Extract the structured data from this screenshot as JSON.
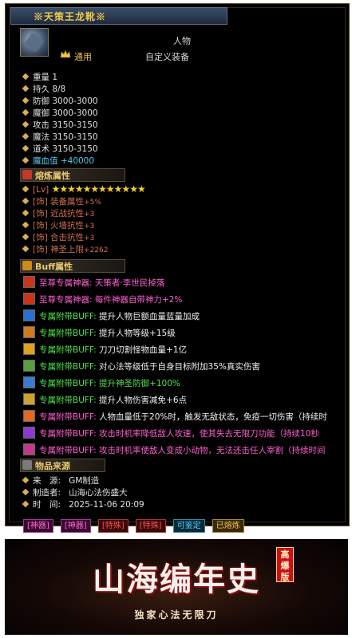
{
  "item": {
    "title": "※天策王龙靴※",
    "type": "人物",
    "rarity": "通用",
    "custom_label": "自定义装备"
  },
  "stats": [
    {
      "label": "重量",
      "value": "1"
    },
    {
      "label": "持久",
      "value": "8/8"
    },
    {
      "label": "防御",
      "value": "3000-3000"
    },
    {
      "label": "魔御",
      "value": "3000-3000"
    },
    {
      "label": "攻击",
      "value": "3150-3150"
    },
    {
      "label": "魔法",
      "value": "3150-3150"
    },
    {
      "label": "道术",
      "value": "3150-3150"
    },
    {
      "label": "魔血值",
      "value": "+40000"
    }
  ],
  "refine": {
    "header": "熔炼属性",
    "level_label": "[Lv]",
    "stars": "★★★★★★★★★★★★",
    "rows": [
      {
        "tag": "[饰]",
        "name": "装备属性",
        "bonus": "+5%"
      },
      {
        "tag": "[饰]",
        "name": "近战抗性",
        "bonus": "+3"
      },
      {
        "tag": "[饰]",
        "name": "火墙抗性",
        "bonus": "+3"
      },
      {
        "tag": "[饰]",
        "name": "合击抗性",
        "bonus": "+3"
      },
      {
        "tag": "[饰]",
        "name": "神圣上限",
        "bonus": "+2262"
      }
    ]
  },
  "buff": {
    "header": "Buff属性",
    "rows": [
      {
        "prefix": "至尊专属神器:",
        "text": "天策者·李世民掉落"
      },
      {
        "prefix": "至尊专属神器:",
        "text": "每件神器自带神力+2%"
      },
      {
        "prefix": "专属附带BUFF:",
        "text": "提升人物巨额血量蓝量加成"
      },
      {
        "prefix": "专属附带BUFF:",
        "text": "提升人物等级+15级"
      },
      {
        "prefix": "专属附带BUFF:",
        "text": "刀刀切割怪物血量+1亿"
      },
      {
        "prefix": "专属附带BUFF:",
        "text": "对心法等级低于自身目标附加35%真实伤害"
      },
      {
        "prefix": "专属附带BUFF:",
        "text": "提升神圣防御+100%"
      },
      {
        "prefix": "专属附带BUFF:",
        "text": "提升人物伤害减免+6点"
      },
      {
        "prefix": "专属附带BUFF:",
        "text": "人物血量低于20%时，触发无敌状态，免疫一切伤害（持续时"
      },
      {
        "prefix": "专属附带BUFF:",
        "text": "攻击时机率降低敌人攻速，使其失去无限刀功能（持续10秒"
      },
      {
        "prefix": "专属附带BUFF:",
        "text": "攻击时机率使敌人变成小动物，无法还击任人宰割（持续时间"
      }
    ]
  },
  "source": {
    "header": "物品来源",
    "rows": [
      {
        "label": "来　源:",
        "value": "GM制造"
      },
      {
        "label": "制造者:",
        "value": "山海心法伤盛大"
      },
      {
        "label": "时　间:",
        "value": "2025-11-06 20:09"
      }
    ]
  },
  "tags": [
    "[神器]",
    "[神器]",
    "[特殊]",
    "[特殊]",
    "可鉴定",
    "已熔炼"
  ],
  "banner": {
    "title": "山海编年史",
    "badge": "高爆版",
    "subtitle": "独家心法无限刀"
  },
  "colors": {
    "gold": "#f3c84a",
    "pink": "#ff5fd2",
    "green": "#50e050",
    "refine_red": "#d07050",
    "cyan": "#59c8f0"
  }
}
